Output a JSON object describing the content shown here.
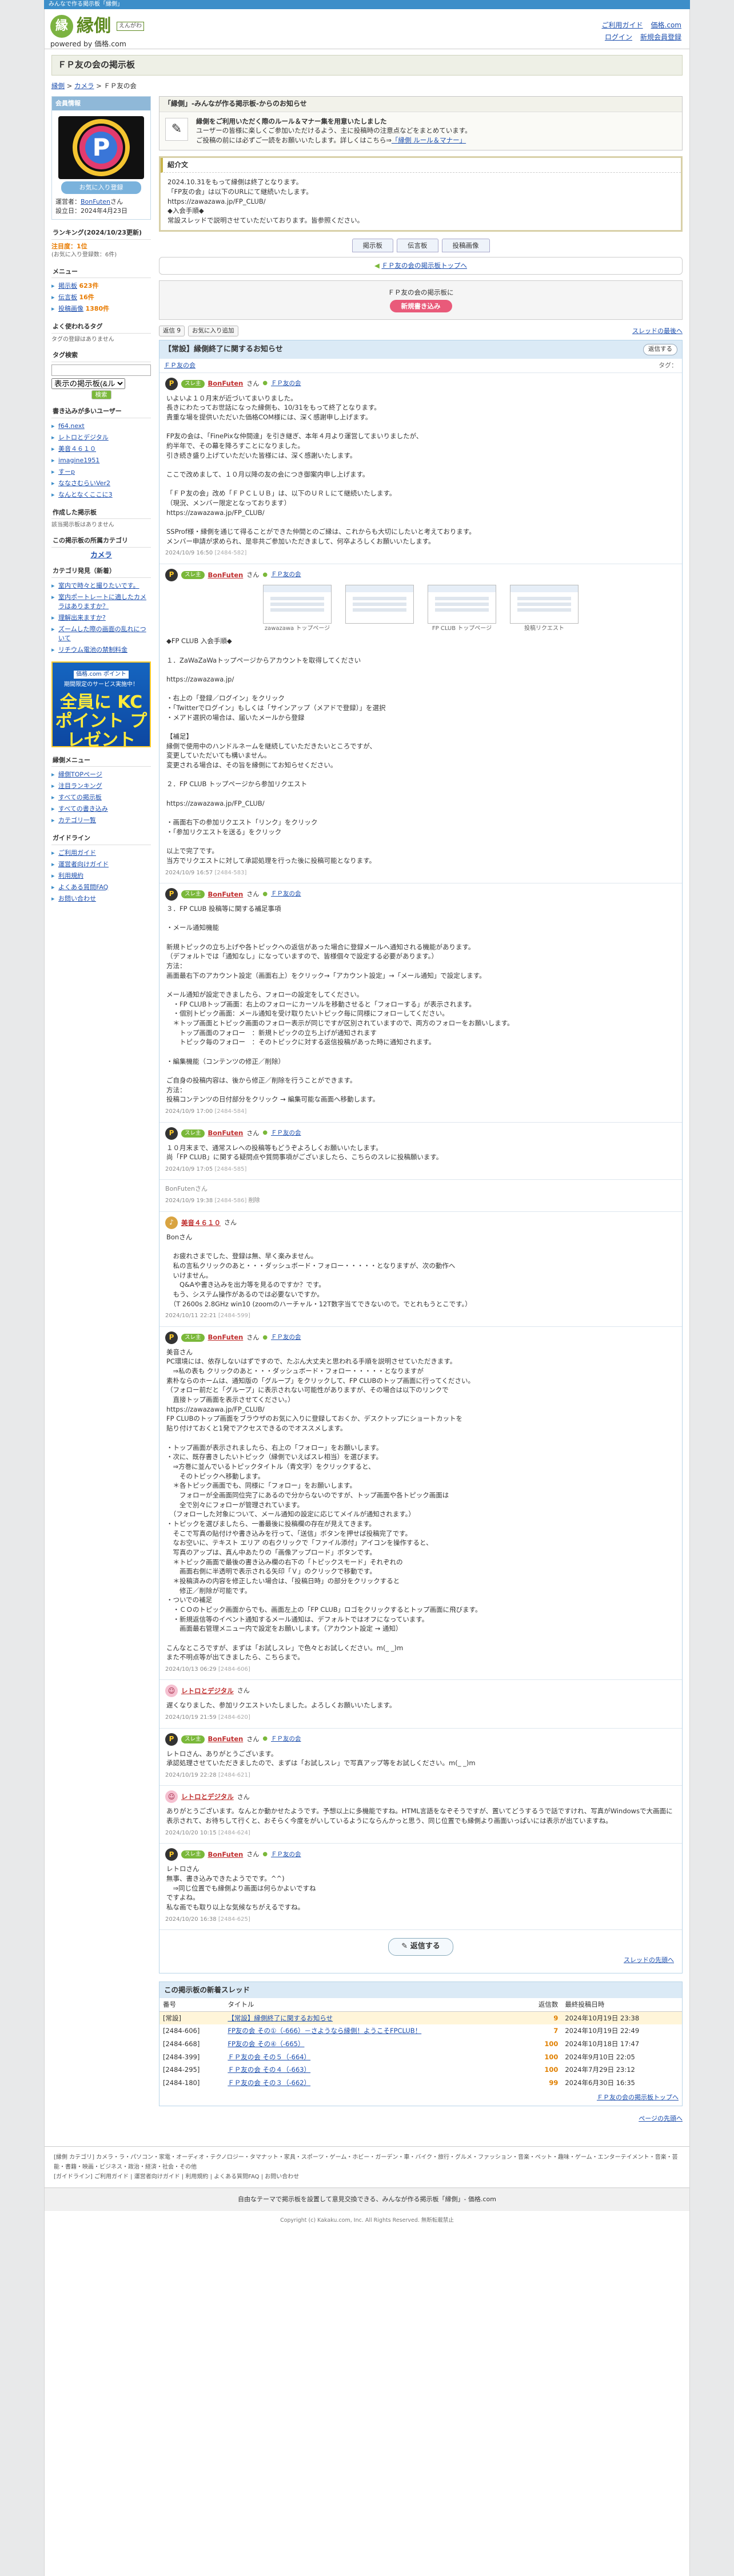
{
  "top_strip": "みんなで作る掲示板「縁側」",
  "header": {
    "logo_text": "縁側",
    "logo_sub": "えんがわ",
    "powered": "powered by 価格.com",
    "links": [
      "ご利用ガイド",
      "価格.com",
      "ログイン",
      "新規会員登録"
    ]
  },
  "page_title": "ＦＰ友の会の掲示板",
  "breadcrumb": [
    "縁側",
    "カメラ",
    "ＦＰ友の会"
  ],
  "sidebar": {
    "owner_head": "会員情報",
    "fav_btn": "お気に入り登録",
    "owner_label": "運営者：",
    "owner_name": "BonFuten",
    "owner_suffix": "さん",
    "since": "設立日：2024年4月23日",
    "ranking_head": "ランキング(2024/10/23更新)",
    "ranking_lines": [
      "注目度：1位",
      "(お気に入り登録数：6件)"
    ],
    "menu_head": "メニュー",
    "menu_items": [
      {
        "label": "掲示板",
        "count": "623件"
      },
      {
        "label": "伝言板",
        "count": "16件"
      },
      {
        "label": "投稿画像",
        "count": "1380件"
      }
    ],
    "visitors_head": "よく使われるタグ",
    "visitors_text": "タグの登録はありません",
    "tag_head": "タグ検索",
    "tag_select": "表示の掲示板(&ル",
    "tag_btn": "検索",
    "members_head": "書き込みが多いユーザー",
    "members": [
      "f64.next",
      "レトロとデジタル",
      "美音４６１０",
      "imagine1951",
      "すーp",
      "ななさむらいVer2",
      "なんとなくここに3"
    ],
    "author_head": "作成した掲示板",
    "author_text": "該当掲示板はありません",
    "cat_head": "この掲示板の所属カテゴリ",
    "cat_name": "カメラ",
    "cat_related_head": "カテゴリ発見（新着）",
    "cat_related": [
      "室内で時々と撮りたいです。",
      "室内ポートレートに適したカメラはありますか？",
      "理解出来ますか?",
      "ズームした際の画面の乱れについて",
      "リチウム電池の禁制料金"
    ],
    "banner_top": "価格.com ポイント",
    "banner_mid": "期間限定のサービス実施中！",
    "banner_big": "全員に KCポイント プレゼント",
    "engawa_menu_head": "縁側メニュー",
    "engawa_menu": [
      "縁側TOPページ",
      "注目ランキング",
      "すべての掲示板",
      "すべての書き込み",
      "カテゴリ一覧"
    ],
    "guide_head": "ガイドライン",
    "guide_items": [
      "ご利用ガイド",
      "運営者向けガイド",
      "利用規約",
      "よくある質問FAQ",
      "お問い合わせ"
    ]
  },
  "notice": {
    "title": "「縁側」-みんなが作る掲示板-からのお知らせ",
    "line1": "縁側をご利用いただく際のルール＆マナー集を用意いたしました",
    "line2": "ユーザーの皆様に楽しくご参加いただけるよう、主に投稿時の注意点などをまとめています。",
    "line3": "ご投稿の前には必ずご一読をお願いいたします。詳しくはこちら⇒",
    "link": "「縁側 ルール＆マナー」"
  },
  "intro": {
    "head": "紹介文",
    "body": "2024.10.31をもって縁側は終了となります。\n「FP友の会」は以下のURLにて継続いたします。\nhttps://zawazawa.jp/FP_CLUB/\n◆入会手順◆\n常設スレッドで説明させていただいております。皆参照ください。"
  },
  "tabs": [
    "掲示板",
    "伝言板",
    "投稿画像"
  ],
  "top_link": "ＦＰ友の会の掲示板トップへ",
  "join": {
    "text": "ＦＰ友の会の掲示板に",
    "btn": "新規書き込み"
  },
  "controls": {
    "count": "返信 9",
    "fav": "お気に入り追加",
    "right": "スレッドの最後へ"
  },
  "thread": {
    "title": "【常設】縁側終了に関するお知らせ",
    "reply_btn": "返信する",
    "category": "ＦＰ友の会",
    "tag": "タグ："
  },
  "posts": [
    {
      "user": "BonFuten",
      "avatar": "dark",
      "badge": "スレ主",
      "grp": "ＦＰ友の会",
      "body": "いよいよ１０月末が近づいてまいりました。\n長きにわたってお世話になった縁側も、10/31をもって終了となります。\n貴重な場を提供いただいた価格COM様には、深く感謝申し上げます。\n\nFP友の会は、「FinePixな仲間達」を引き継ぎ、本年４月より運営してまいりましたが、\n約半年で、その幕を降ろすことになりました。\n引き続き盛り上げていただいた皆様には、深く感謝いたします。\n\nここで改めまして、１０月以降の友の会につき御案内申し上げます。\n\n「ＦＰ友の会」改め「ＦＰＣＬＵＢ」は、以下のＵＲＬにて継続いたします。\n（現況、メンバー限定となっております）\nhttps://zawazawa.jp/FP_CLUB/\n\nSSProf様・縁側を通じて得ることができた仲間とのご縁は、これからも大切にしたいと考えております。\nメンバー申請が求められ、是非共ご参加いただきまして、何卒よろしくお願いいたします。",
      "date": "2024/10/9 16:50",
      "no": "[2484-582]"
    },
    {
      "user": "BonFuten",
      "avatar": "dark",
      "badge": "スレ主",
      "grp": "ＦＰ友の会",
      "shots": [
        "zawazawa トップページ",
        "",
        "FP CLUB トップページ",
        "投稿リクエスト"
      ],
      "body": "◆FP CLUB 入会手順◆\n\n１．ZaWaZaWaトップページからアカウントを取得してください\n\nhttps://zawazawa.jp/\n\n・右上の「登録／ログイン」をクリック\n・「Twitterでログイン」もしくは「サインアップ（メアドで登録）」を選択\n・メアド選択の場合は、届いたメールから登録\n\n【補足】\n縁側で使用中のハンドルネームを継続していただきたいところですが、\n変更していただいても構いません。\n変更される場合は、その旨を縁側にてお知らせください。\n\n２．FP CLUB トップページから参加リクエスト\n\nhttps://zawazawa.jp/FP_CLUB/\n\n・画面右下の参加リクエスト「リンク」をクリック\n・「参加リクエストを送る」をクリック\n\n以上で完了です。\n当方でリクエストに対して承認処理を行った後に投稿可能となります。",
      "date": "2024/10/9 16:57",
      "no": "[2484-583]"
    },
    {
      "user": "BonFuten",
      "avatar": "dark",
      "badge": "スレ主",
      "grp": "ＦＰ友の会",
      "body": "３．FP CLUB 投稿等に関する補足事項\n\n・メール通知機能\n\n新規トピックの立ち上げや各トピックへの返信があった場合に登録メールへ通知される機能があります。\n（デフォルトでは「通知なし」になっていますので、皆様個々で設定する必要があります。）\n方法：\n画面最右下のアカウント設定（画面右上）をクリック→「アカウント設定」→「メール通知」で設定します。\n\nメール通知が設定できましたら、フォローの設定をしてください。\n　・FP CLUBトップ画面：右上のフォローにカーソルを移動させると「フォローする」が表示されます。\n　・個別トピック画面：メール通知を受け取りたいトピック毎に同様にフォローしてください。\n　＊トップ画面とトピック画面のフォロー表示が同じですが区別されていますので、両方のフォローをお願いします。\n　　トップ画面のフォロー　：新規トピックの立ち上げが通知されます\n　　トピック毎のフォロー　：そのトピックに対する返信投稿があった時に通知されます。\n\n・編集機能（コンテンツの修正／削除）\n\nご自身の投稿内容は、後から修正／削除を行うことができます。\n方法：\n投稿コンテンツの日付部分をクリック → 編集可能な画面へ移動します。",
      "date": "2024/10/9 17:00",
      "no": "[2484-584]"
    },
    {
      "user": "BonFuten",
      "avatar": "dark",
      "badge": "スレ主",
      "grp": "ＦＰ友の会",
      "body": "１０月末まで、通常スレへの投稿等もどうぞよろしくお願いいたします。\n尚「FP CLUB」に関する疑問点や質問事項がございましたら、こちらのスレに投稿願います。",
      "date": "2024/10/9 17:05",
      "no": "[2484-585]"
    },
    {
      "deleted": true,
      "user": "BonFuten",
      "suffix": "さん",
      "date": "2024/10/9 19:38",
      "no": "[2484-586]",
      "note": "削除"
    },
    {
      "user": "美音４６１０",
      "avatar": "gold",
      "badge": "",
      "grp": "",
      "body": "Bonさん\n\n　お疲れさまでした、登録は無、早く楽みません。\n　私の言私クリックのあと・・・ダッシュボード・フォロー・・・・・となりますが、次の動作へ\n　いけません。\n　　Q&Aや書き込みを出力等を見るのですか？です。\n　もう、システム操作があるのでは必要ないですか。\n　（T 2600s 2.8GHz win10 (zoomのハーチャル・12T数字当てできないので。でとれもうとこです。）",
      "date": "2024/10/11 22:21",
      "no": "[2484-599]"
    },
    {
      "user": "BonFuten",
      "avatar": "dark",
      "badge": "スレ主",
      "grp": "ＦＰ友の会",
      "body": "美音さん\nPC環境には、依存しないはずですので、たぶん大丈夫と思われる手順を説明させていただきます。\n　⇒私の表も クリックのあと・・・ダッシュボード・フォロー・・・・・となりますが\n素朴ならのホームは、通知版の「グループ」をクリックして、FP CLUBのトップ画面に行ってください。\n（フォロー前だと「グループ」に表示されない可能性がありますが、その場合は以下のリンクで\n　直接トップ画面を表示させてください。）\nhttps://zawazawa.jp/FP_CLUB/\nFP CLUBのトップ画面をブラウザのお気に入りに登録しておくか、デスクトップにショートカットを\n貼り付けておくと1発でアクセスできるのでオススメします。\n\n・トップ画面が表示されましたら、右上の「フォロー」をお願いします。\n・次に、既存書きしたいトピック（縁側でいえばスレ相当）を選びます。\n　⇒方巻に並んでいるトピックタイトル（青文字）をクリックすると、\n　　そのトピックへ移動します。\n　＊各トピック画面でも、同様に「フォロー」をお願いします。\n　　フォローが全画面同位完了にあるので分からないのですが、トップ画面や各トピック画面は\n　　全で別々にフォローが管理されています。\n　（フォローした対象について、メール通知の設定に応じてメイルが通知されます。）\n・トピックを選びましたら、一番最後に投稿欄の存在が見えてきます。\n　そこで写真の貼付けや書き込みを行って、「送信」ボタンを押せば投稿完了です。\n　なお空いに、テキスト エリア の右クリックで「ファイル添付」アイコンを操作すると、\n　写真のアップは、真ん中あたりの「画像アップロード」ボタンです。\n　＊トピック画面で最後の書き込み欄の右下の「トピックスモード」それぞれの\n　　画面右側に半透明で表示される矢印「Ｖ」のクリックで移動です。\n　＊投稿済みの内容を修正したい場合は、「投稿日時」の部分をクリックすると\n　　修正／削除が可能です。\n・ついでの補足\n　・ＣＯのトピック画面からでも、画面左上の「FP CLUB」ロゴをクリックするとトップ画面に飛びます。\n　・新規返信等のイベント通知するメール通知は、デフォルトではオフになっています。\n　　画面最右管理メニュー内で設定をお願いします。（アカウント設定 → 通知）\n\nこんなところですが、まずは「お試しスレ」で色々とお試しください。m(_ _)m\nまた不明点等が出てきましたら、こちらまで。",
      "date": "2024/10/13 06:29",
      "no": "[2484-606]"
    },
    {
      "user": "レトロとデジタル",
      "avatar": "pink",
      "badge": "",
      "grp": "",
      "body": "遅くなりました、参加リクエストいたしました。よろしくお願いいたします。",
      "date": "2024/10/19 21:59",
      "no": "[2484-620]"
    },
    {
      "user": "BonFuten",
      "avatar": "dark",
      "badge": "スレ主",
      "grp": "ＦＰ友の会",
      "body": "レトロさん、ありがとうございます。\n承認処理させていただきましたので、まずは「お試しスレ」で写真アップ等をお試しください。m(_ _)m",
      "date": "2024/10/19 22:28",
      "no": "[2484-621]"
    },
    {
      "user": "レトロとデジタル",
      "avatar": "pink",
      "badge": "",
      "grp": "",
      "body": "ありがとうございます。なんとか動かせたようです。予想以上に多機能ですね。HTML言語をなぞそうですが、置いてどうするうで話ですけれ、写真がWindowsで大画面に表示されて、お待ちして行くと、おそらく今度をがいしているようにならんかっと思う、同じ位置でも縁側より画面いっぱいには表示が出ていますね。",
      "date": "2024/10/20 10:15",
      "no": "[2484-624]"
    },
    {
      "user": "BonFuten",
      "avatar": "dark",
      "badge": "スレ主",
      "grp": "ＦＰ友の会",
      "body": "レトロさん\n無事、書き込みできたようでです。^^)\n　⇒同じ位置でも縁側より画面は何らかよいですね\nですよね。\n私な画でも取り以上な気候なちがえるですね。",
      "date": "2024/10/20 16:38",
      "no": "[2484-625]"
    }
  ],
  "reply_area_btn": "返信する",
  "thread_top_link": "スレッドの先頭へ",
  "recent": {
    "head": "この掲示板の新着スレッド",
    "cols": [
      "番号",
      "タイトル",
      "返信数",
      "最終投稿日時"
    ],
    "rows": [
      {
        "no": "[常設]",
        "title": "【常設】縁側終了に関するお知らせ",
        "cnt": "9",
        "date": "2024年10月19日 23:38"
      },
      {
        "no": "[2484-606]",
        "title": "FP友の会 その①（-666）－さようなら縁側！ようこそFPCLUB！",
        "cnt": "7",
        "date": "2024年10月19日 22:49"
      },
      {
        "no": "[2484-668]",
        "title": "FP友の会 その④（-665）",
        "cnt": "100",
        "date": "2024年10月18日 17:47"
      },
      {
        "no": "[2484-399]",
        "title": "ＦＰ友の会 その５（-664）",
        "cnt": "100",
        "date": "2024年9月10日 22:05"
      },
      {
        "no": "[2484-295]",
        "title": "ＦＰ友の会 その４（-663）",
        "cnt": "100",
        "date": "2024年7月29日 23:12"
      },
      {
        "no": "[2484-180]",
        "title": "ＦＰ友の会 その３（-662）",
        "cnt": "99",
        "date": "2024年6月30日 16:35"
      }
    ],
    "top_link": "ＦＰ友の会の掲示板トップへ"
  },
  "pagetop": "ページの先頭へ",
  "footer": {
    "cats": "[縁側 カテゴリ] カメラ・ラ・パソコン・家電・オーディオ・テクノロジー・タマナット・家具・スポーツ・ゲーム・ホビー・ガーデン・車・バイク・旅行・グルメ・ファッション・音楽・ペット・趣味・ゲーム・エンターテイメント・音楽・芸能・書籍・映画・ビジネス・政治・経済・社会・その他",
    "guide": "[ガイドライン] ご利用ガイド | 運営者向けガイド | 利用規約 | よくある質問FAQ | お問い合わせ",
    "bottom": "自由なテーマで掲示板を設置して意見交換できる、みんなが作る掲示板「縁側」- 価格.com",
    "copyright": "Copyright (c) Kakaku.com, Inc. All Rights Reserved. 無断転載禁止"
  }
}
